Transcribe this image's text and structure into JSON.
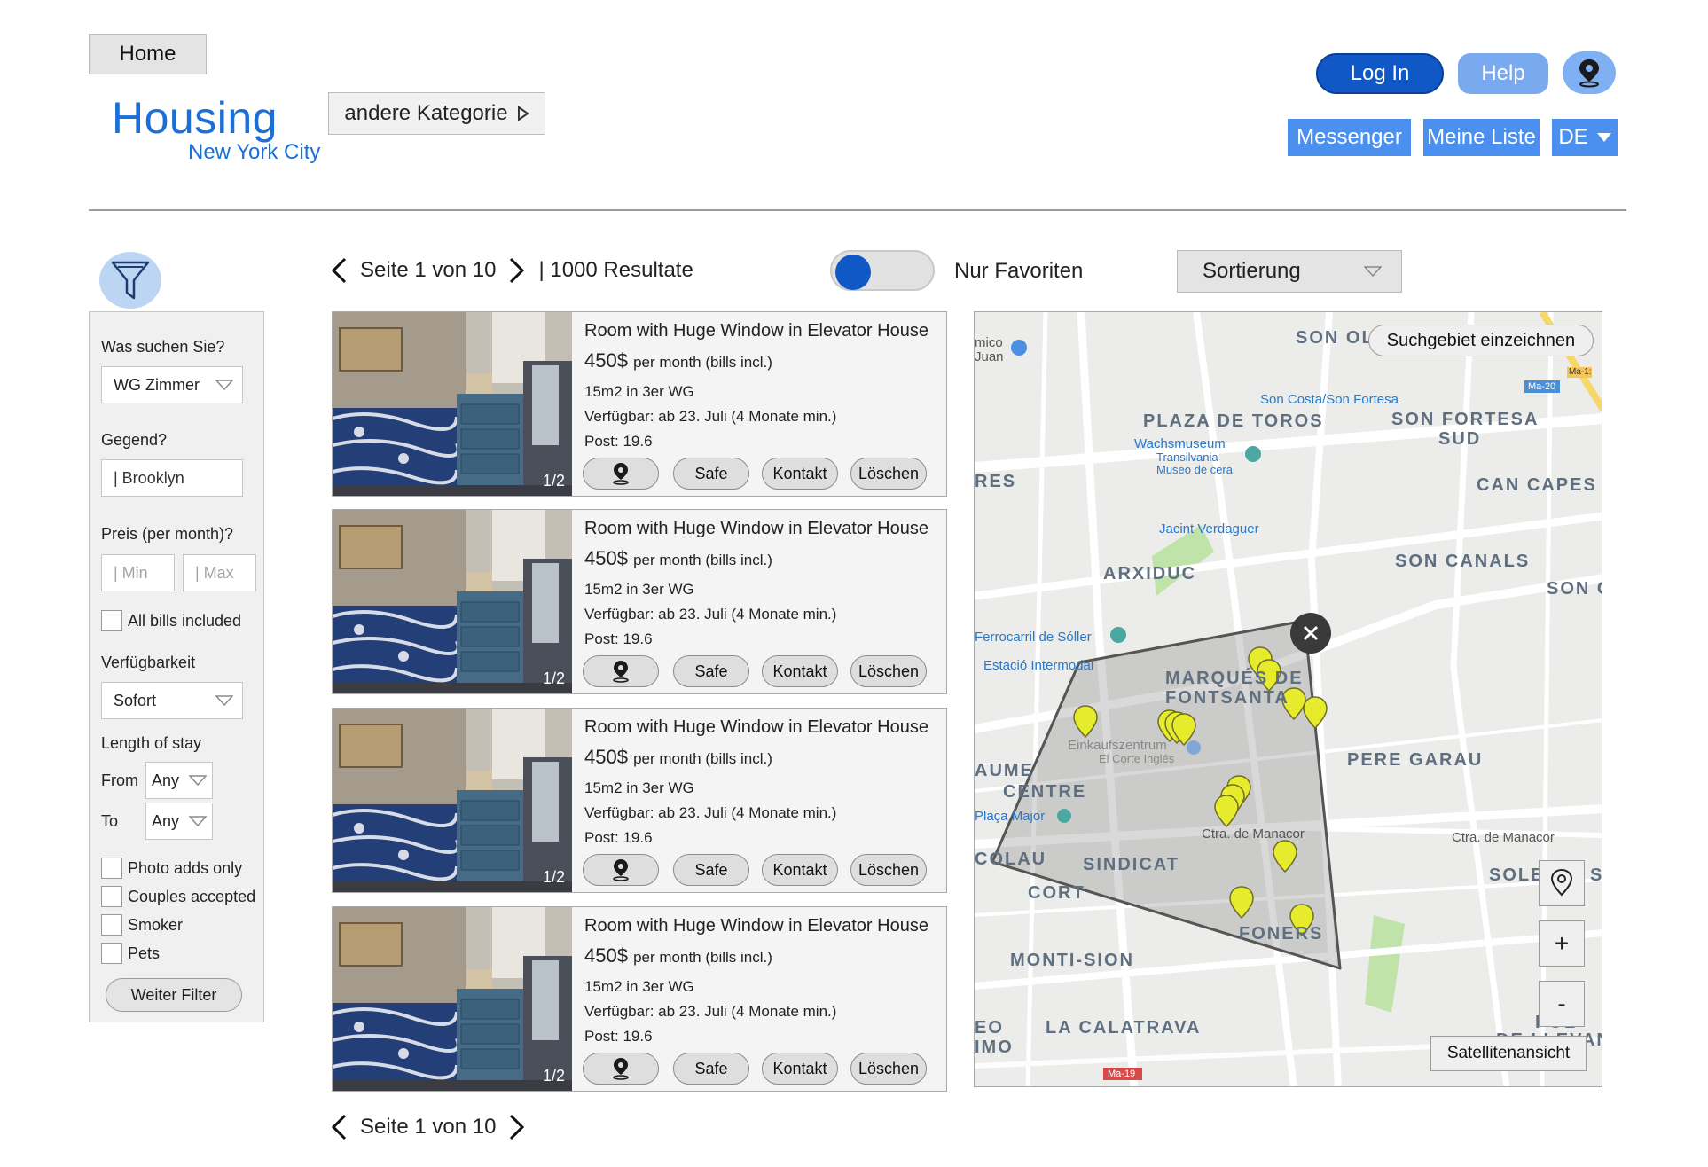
{
  "header": {
    "home_label": "Home",
    "brand": "Housing",
    "city": "New York City",
    "category_label": "andere Kategorie",
    "login_label": "Log In",
    "help_label": "Help",
    "messenger_label": "Messenger",
    "mylist_label": "Meine Liste",
    "language_label": "DE"
  },
  "toolbar": {
    "page_info": "Seite 1 von 10",
    "results": "| 1000 Resultate",
    "favorites_label": "Nur Favoriten",
    "sort_label": "Sortierung"
  },
  "filters": {
    "search_label": "Was suchen Sie?",
    "search_value": "WG Zimmer",
    "area_label": "Gegend?",
    "area_value": "| Brooklyn",
    "price_label": "Preis (per month)?",
    "min_placeholder": "| Min",
    "max_placeholder": "| Max",
    "bills_label": "All bills included",
    "availability_label": "Verfügbarkeit",
    "availability_value": "Sofort",
    "stay_label": "Length of stay",
    "from_label": "From",
    "from_value": "Any",
    "to_label": "To",
    "to_value": "Any",
    "checkboxes": [
      "Photo adds only",
      "Couples accepted",
      "Smoker",
      "Pets"
    ],
    "more_label": "Weiter Filter"
  },
  "listings": [
    {
      "title": "Room with Huge Window in Elevator House",
      "price": "450$",
      "price_note": "per month (bills incl.)",
      "size": "15m2 in 3er WG",
      "available": "Verfügbar: ab 23. Juli (4 Monate min.)",
      "post": "Post: 19.6",
      "photo_counter": "1/2"
    },
    {
      "title": "Room with Huge Window in Elevator House",
      "price": "450$",
      "price_note": "per month (bills incl.)",
      "size": "15m2 in 3er WG",
      "available": "Verfügbar: ab 23. Juli (4 Monate min.)",
      "post": "Post: 19.6",
      "photo_counter": "1/2"
    },
    {
      "title": "Room with Huge Window in Elevator House",
      "price": "450$",
      "price_note": "per month (bills incl.)",
      "size": "15m2 in 3er WG",
      "available": "Verfügbar: ab 23. Juli (4 Monate min.)",
      "post": "Post: 19.6",
      "photo_counter": "1/2"
    },
    {
      "title": "Room with Huge Window in Elevator House",
      "price": "450$",
      "price_note": "per month (bills incl.)",
      "size": "15m2 in 3er WG",
      "available": "Verfügbar: ab 23. Juli (4 Monate min.)",
      "post": "Post: 19.6",
      "photo_counter": "1/2"
    }
  ],
  "listing_actions": {
    "save": "Safe",
    "contact": "Kontakt",
    "delete": "Löschen"
  },
  "map": {
    "draw_area_label": "Suchgebiet einzeichnen",
    "satellite_label": "Satellitenansicht",
    "zoom_in": "+",
    "zoom_out": "-",
    "labels": {
      "son_ol": "SON OL",
      "plaza_toros": "PLAZA DE TOROS",
      "son_fortesa": "SON FORTESA",
      "sud": "SUD",
      "can_capes": "CAN CAPES",
      "res": "RES",
      "arxiduc": "ARXIDUC",
      "son_canals": "SON CANALS",
      "son_g": "SON G",
      "marques": "MARQUÉS DE",
      "fontsanta": "FONTSANTA",
      "pere_garau": "PERE GARAU",
      "aume": "AUME",
      "centre": "CENTRE",
      "colau": "COLAU",
      "sindicat": "SINDICAT",
      "cort": "CORT",
      "foners": "FONERS",
      "sole": "SOLE",
      "s": "S",
      "monti_sion": "MONTI-SION",
      "la_calatrava": "LA CALATRAVA",
      "eo": "EO",
      "imo": "IMO",
      "pol": "POL",
      "de_llevant": "DE LLEVANT",
      "son_costa": "Son Costa/Son Fortesa",
      "wachsmuseum": "Wachsmuseum",
      "transilvania": "Transilvania",
      "museo_cera": "Museo de cera",
      "jacint": "Jacint Verdaguer",
      "ferrocarril": "Ferrocarril de Sóller",
      "estacio": "Estació Intermodal",
      "einkauf": "Einkaufszentrum",
      "corte": "El Corte Inglés",
      "placa_major": "Plaça Major",
      "ctra_manacor": "Ctra. de Manacor",
      "ctra_manacor2": "Ctra. de Manacor",
      "mico": "mico",
      "juan": "Juan",
      "ma20": "Ma-20",
      "ma19": "Ma-19",
      "ma1": "Ma-1:"
    }
  },
  "bottom_pager": "Seite 1 von 10",
  "colors": {
    "primary": "#1158c7",
    "secondary": "#4b90ee",
    "light_blue": "#79aaf0",
    "pin": "#e6ec2c"
  }
}
